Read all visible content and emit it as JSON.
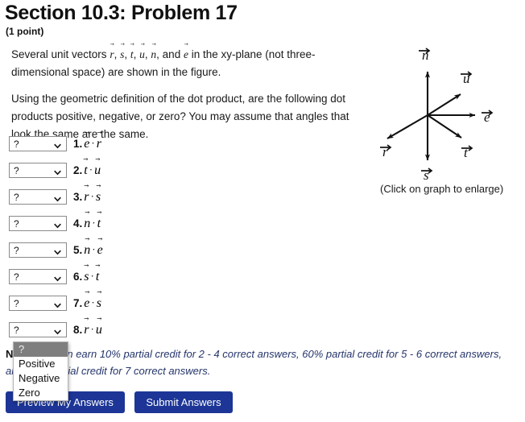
{
  "header": {
    "title": "Section 10.3: Problem 17",
    "point_value": "(1 point)"
  },
  "problem": {
    "intro_prefix": "Several unit vectors ",
    "intro_vectors": [
      "r",
      "s",
      "t",
      "u",
      "n",
      "e"
    ],
    "intro_suffix": " in the xy-plane (not three-dimensional space) are shown in the figure.",
    "intro_full": "Several unit vectors r, s, t, u, n, and e in the xy-plane (not three-dimensional space) are shown in the figure.",
    "question": "Using the geometric definition of the dot product, are the following dot products positive, negative, or zero? You may assume that angles that look the same are the same."
  },
  "answers": {
    "select_value": "?",
    "options": [
      "?",
      "Positive",
      "Negative",
      "Zero"
    ],
    "highlighted_option": "?",
    "rows": [
      {
        "index": "1.",
        "left": "e",
        "right": "r"
      },
      {
        "index": "2.",
        "left": "t",
        "right": "u"
      },
      {
        "index": "3.",
        "left": "r",
        "right": "s"
      },
      {
        "index": "4.",
        "left": "n",
        "right": "t"
      },
      {
        "index": "5.",
        "left": "n",
        "right": "e"
      },
      {
        "index": "6.",
        "left": "s",
        "right": "t"
      },
      {
        "index": "7.",
        "left": "e",
        "right": "s"
      },
      {
        "index": "8.",
        "left": "r",
        "right": "u"
      }
    ]
  },
  "note": {
    "lead": "Note:",
    "text": " You can earn 10% partial credit for 2 - 4 correct answers, 60% partial credit for 5 - 6 correct answers, and 80% partial credit for 7 correct answers."
  },
  "buttons": {
    "preview": "Preview My Answers",
    "submit": "Submit Answers"
  },
  "figure": {
    "caption": "(Click on graph to enlarge)",
    "labels": {
      "n": "n",
      "u": "u",
      "e": "e",
      "t": "t",
      "s": "s",
      "r": "r"
    }
  },
  "colors": {
    "button_blue": "#1c3596",
    "note_blue": "#25356b",
    "dropdown_highlight": "#7f7f7f"
  }
}
